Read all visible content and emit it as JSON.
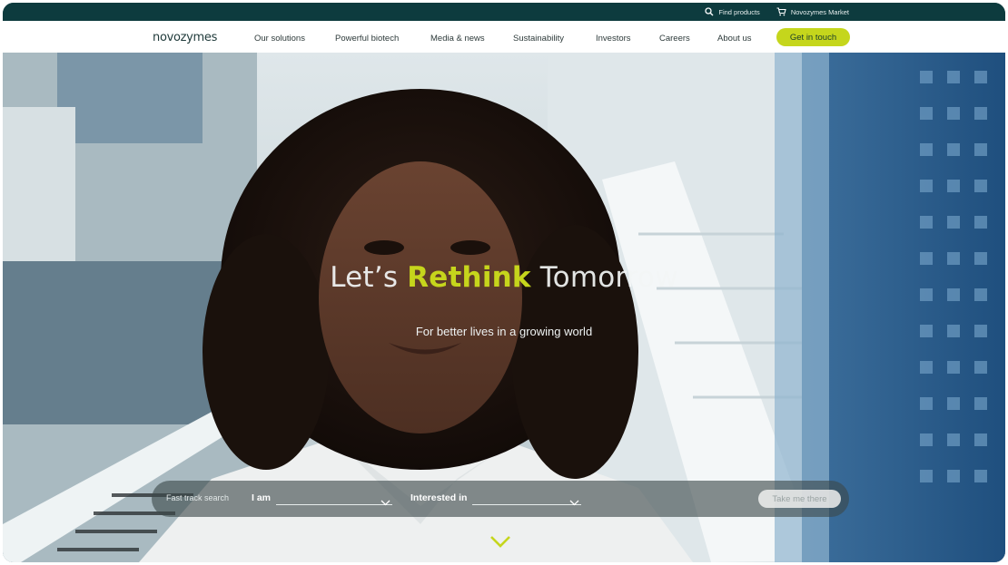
{
  "utility": {
    "find_products": "Find products",
    "market": "Novozymes Market"
  },
  "nav": {
    "logo": "novozymes",
    "items": [
      "Our solutions",
      "Powerful biotech",
      "Media & news",
      "Sustainability",
      "Investors",
      "Careers",
      "About us"
    ],
    "cta": "Get in touch"
  },
  "hero": {
    "headline_pre": "Let’s ",
    "headline_accent": "Rethink",
    "headline_post": " Tomorrow",
    "subline": "For better lives in a growing world"
  },
  "fast_track": {
    "label": "Fast track search",
    "i_am_label": "I am",
    "i_am_value": "",
    "interested_label": "Interested in",
    "interested_value": "",
    "button": "Take me there"
  },
  "colors": {
    "brand_dark": "#0d3b3e",
    "accent_lime": "#c5d61c"
  },
  "icons": {
    "find_products": "search-icon",
    "market": "cart-icon",
    "dropdowns": "chevron-down-icon",
    "scroll": "chevron-down-icon"
  }
}
